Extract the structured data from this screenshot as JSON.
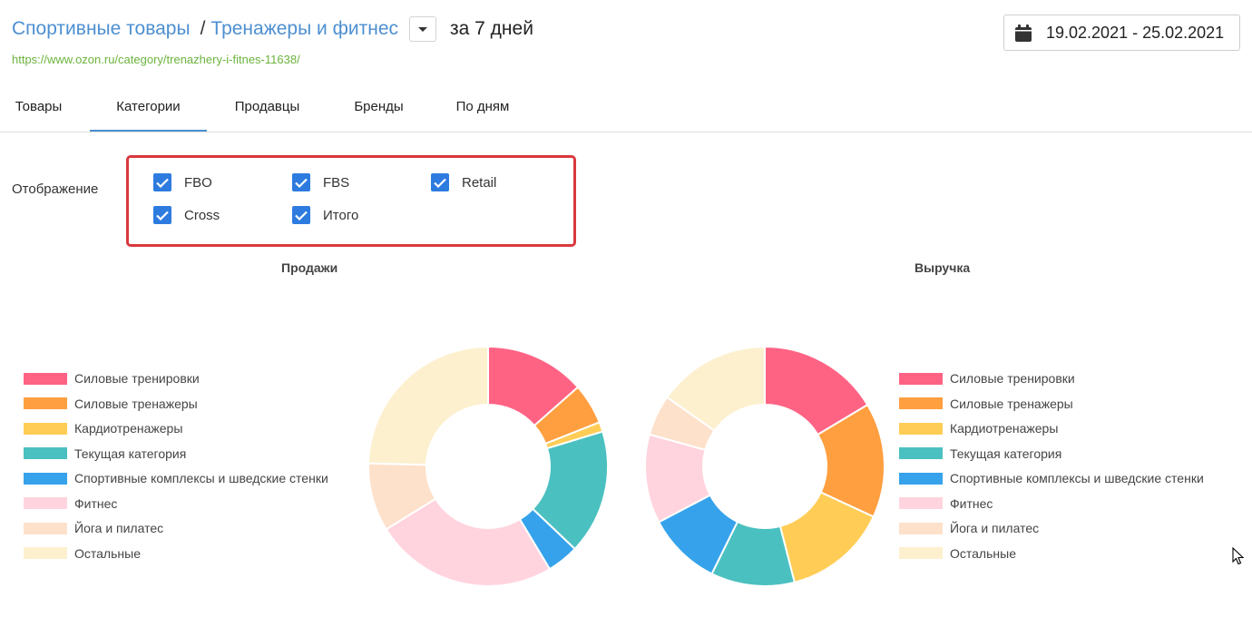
{
  "breadcrumb": {
    "category": "Спортивные товары",
    "separator": "/",
    "subcategory": "Тренажеры и фитнес",
    "period": "за 7 дней"
  },
  "url": "https://www.ozon.ru/category/trenazhery-i-fitnes-11638/",
  "date_range": "19.02.2021 - 25.02.2021",
  "tabs": [
    {
      "label": "Товары",
      "active": false
    },
    {
      "label": "Категории",
      "active": true
    },
    {
      "label": "Продавцы",
      "active": false
    },
    {
      "label": "Бренды",
      "active": false
    },
    {
      "label": "По дням",
      "active": false
    }
  ],
  "display": {
    "label": "Отображение",
    "options": [
      {
        "label": "FBO",
        "checked": true
      },
      {
        "label": "FBS",
        "checked": true
      },
      {
        "label": "Retail",
        "checked": true
      },
      {
        "label": "Cross",
        "checked": true
      },
      {
        "label": "Итого",
        "checked": true
      }
    ]
  },
  "colors": {
    "accent": "#4d8fd1",
    "url_green": "#6cb33e",
    "highlight_red": "#d9383c",
    "checkbox": "#2e7be0"
  },
  "chart_data": [
    {
      "type": "pie",
      "title": "Продажи",
      "legend_position": "left",
      "categories": [
        "Силовые тренировки",
        "Силовые тренажеры",
        "Кардиотренажеры",
        "Текущая категория",
        "Спортивные комплексы и шведские стенки",
        "Фитнес",
        "Йога и пилатес",
        "Остальные"
      ],
      "values": [
        13.5,
        5.5,
        1.3,
        16.8,
        4.3,
        24.8,
        9.2,
        24.6
      ],
      "colors": [
        "#ff6384",
        "#ff9f40",
        "#ffcd56",
        "#4bc0c0",
        "#36a2eb",
        "#ffd4de",
        "#fde1cb",
        "#fdf0cf"
      ]
    },
    {
      "type": "pie",
      "title": "Выручка",
      "legend_position": "right",
      "categories": [
        "Силовые тренировки",
        "Силовые тренажеры",
        "Кардиотренажеры",
        "Текущая категория",
        "Спортивные комплексы и шведские стенки",
        "Фитнес",
        "Йога и пилатес",
        "Остальные"
      ],
      "values": [
        16.4,
        15.5,
        14.1,
        11.3,
        10.0,
        12.0,
        5.5,
        15.2
      ],
      "colors": [
        "#ff6384",
        "#ff9f40",
        "#ffcd56",
        "#4bc0c0",
        "#36a2eb",
        "#ffd4de",
        "#fde1cb",
        "#fdf0cf"
      ]
    }
  ]
}
